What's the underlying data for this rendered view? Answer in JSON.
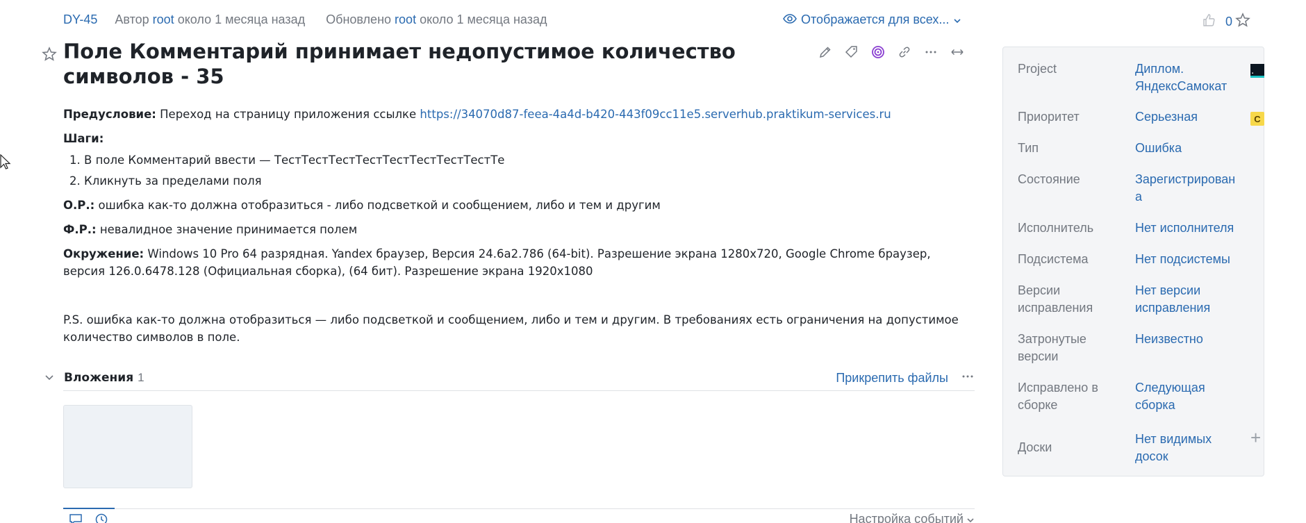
{
  "meta": {
    "issue_id": "DY-45",
    "author_prefix": "Автор",
    "author": "root",
    "created": "около 1 месяца назад",
    "updated_prefix": "Обновлено",
    "updater": "root",
    "updated": "около 1 месяца назад",
    "visibility": "Отображается для всех...",
    "vote_count": "0"
  },
  "title": "Поле Комментарий принимает недопустимое количество символов - 35",
  "description": {
    "precondition_label": "Предусловие:",
    "precondition_text": "Переход на страницу приложения ссылке",
    "precondition_link": "https://34070d87-feea-4a4d-b420-443f09cc11e5.serverhub.praktikum-services.ru",
    "steps_label": "Шаги:",
    "steps": [
      "В поле Комментарий ввести — ТестТестТестТестТестТестТестТестТе",
      "Кликнуть за пределами поля"
    ],
    "expected_label": "О.Р.:",
    "expected_text": "ошибка как-то должна отобразиться - либо подсветкой и сообщением, либо и тем и другим",
    "actual_label": "Ф.Р.:",
    "actual_text": "невалидное значение принимается полем",
    "env_label": "Окружение:",
    "env_text": "Windows 10 Pro 64 разрядная. Yandex браузер, Версия 24.6a2.786 (64-bit). Разрешение экрана 1280x720, Google Chrome браузер, версия 126.0.6478.128 (Официальная сборка), (64 бит). Разрешение экрана 1920x1080",
    "ps_text": "P.S. ошибка как-то должна отобразиться — либо подсветкой и сообщением, либо и тем и другим. В требованиях есть ограничения на допустимое количество символов в поле."
  },
  "attachments": {
    "label": "Вложения",
    "count": "1",
    "attach_button": "Прикрепить файлы"
  },
  "activity": {
    "settings_label": "Настройка событий"
  },
  "fields": [
    {
      "key": "Project",
      "value": "Диплом. ЯндексСамокат"
    },
    {
      "key": "Приоритет",
      "value": "Серьезная",
      "badge": "С"
    },
    {
      "key": "Тип",
      "value": "Ошибка"
    },
    {
      "key": "Состояние",
      "value": "Зарегистрирована"
    },
    {
      "key": "Исполнитель",
      "value": "Нет исполнителя"
    },
    {
      "key": "Подсистема",
      "value": "Нет подсистемы"
    },
    {
      "key": "Версии исправления",
      "value": "Нет версии исправления"
    },
    {
      "key": "Затронутые версии",
      "value": "Неизвестно"
    },
    {
      "key": "Исправлено в сборке",
      "value": "Следующая сборка"
    },
    {
      "key": "Доски",
      "value": "Нет видимых досок"
    }
  ],
  "colors": {
    "link": "#2a6ab0",
    "muted": "#737880",
    "priority_badge": "#f7d84a",
    "panel_bg": "#f4f5f7"
  }
}
